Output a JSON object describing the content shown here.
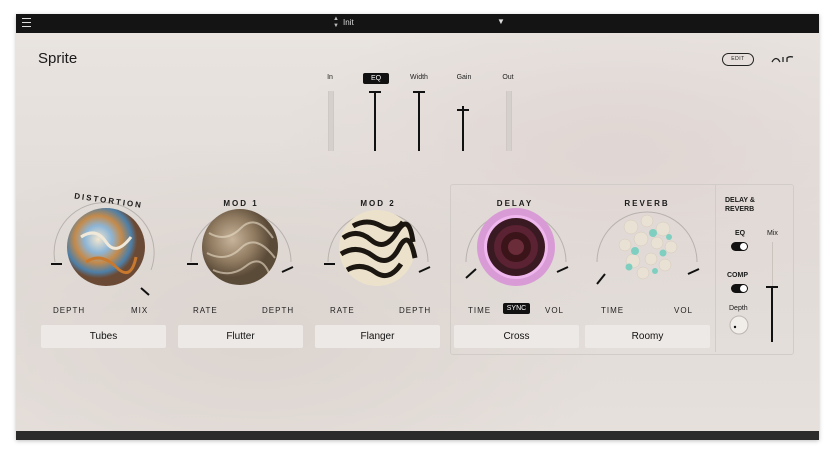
{
  "topbar": {
    "preset": "Init"
  },
  "header": {
    "title": "Sprite",
    "edit_label": "EDIT"
  },
  "faders": [
    {
      "label": "In",
      "value": 0.0
    },
    {
      "label": "EQ",
      "value": 0.95
    },
    {
      "label": "Width",
      "value": 0.95
    },
    {
      "label": "Gain",
      "value": 0.7
    },
    {
      "label": "Out",
      "value": 0.0
    }
  ],
  "modules": [
    {
      "title": "DISTORTION",
      "left_label": "DEPTH",
      "right_label": "MIX",
      "preset": "Tubes"
    },
    {
      "title": "MOD 1",
      "left_label": "RATE",
      "right_label": "DEPTH",
      "preset": "Flutter"
    },
    {
      "title": "MOD 2",
      "left_label": "RATE",
      "right_label": "DEPTH",
      "preset": "Flanger"
    },
    {
      "title": "DELAY",
      "left_label": "TIME",
      "right_label": "VOL",
      "preset": "Cross",
      "sync_label": "SYNC"
    },
    {
      "title": "REVERB",
      "left_label": "TIME",
      "right_label": "VOL",
      "preset": "Roomy"
    }
  ],
  "side": {
    "title_line1": "DELAY &",
    "title_line2": "REVERB",
    "eq_label": "EQ",
    "comp_label": "COMP",
    "depth_label": "Depth",
    "mix_label": "Mix",
    "eq_on": true,
    "comp_on": true
  }
}
